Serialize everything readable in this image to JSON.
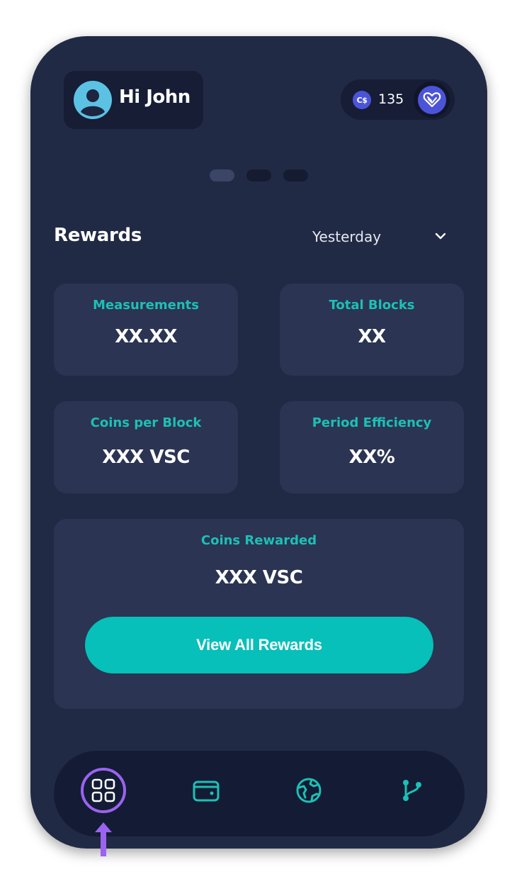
{
  "header": {
    "greeting": "Hi John",
    "balance": {
      "currency_icon": "C$",
      "value": "135"
    }
  },
  "carousel": {
    "dots": [
      true,
      false,
      false
    ]
  },
  "rewards": {
    "title": "Rewards",
    "period": "Yesterday",
    "cards": [
      {
        "label": "Measurements",
        "value": "XX.XX"
      },
      {
        "label": "Total Blocks",
        "value": "XX"
      },
      {
        "label": "Coins per Block",
        "value": "XXX VSC"
      },
      {
        "label": "Period Efficiency",
        "value": "XX%"
      }
    ],
    "coins_rewarded": {
      "label": "Coins Rewarded",
      "value": "XXX VSC"
    },
    "view_all_label": "View All Rewards"
  },
  "nav": {
    "items": [
      {
        "icon": "dashboard-icon",
        "active": true
      },
      {
        "icon": "wallet-icon",
        "active": false
      },
      {
        "icon": "globe-icon",
        "active": false
      },
      {
        "icon": "branch-icon",
        "active": false
      }
    ]
  },
  "colors": {
    "background": "#212a45",
    "card": "#2b3452",
    "accent_teal": "#06c0b9",
    "label_teal": "#1cc0b5",
    "active_purple": "#9a63f0",
    "indigo": "#4b54d8"
  }
}
